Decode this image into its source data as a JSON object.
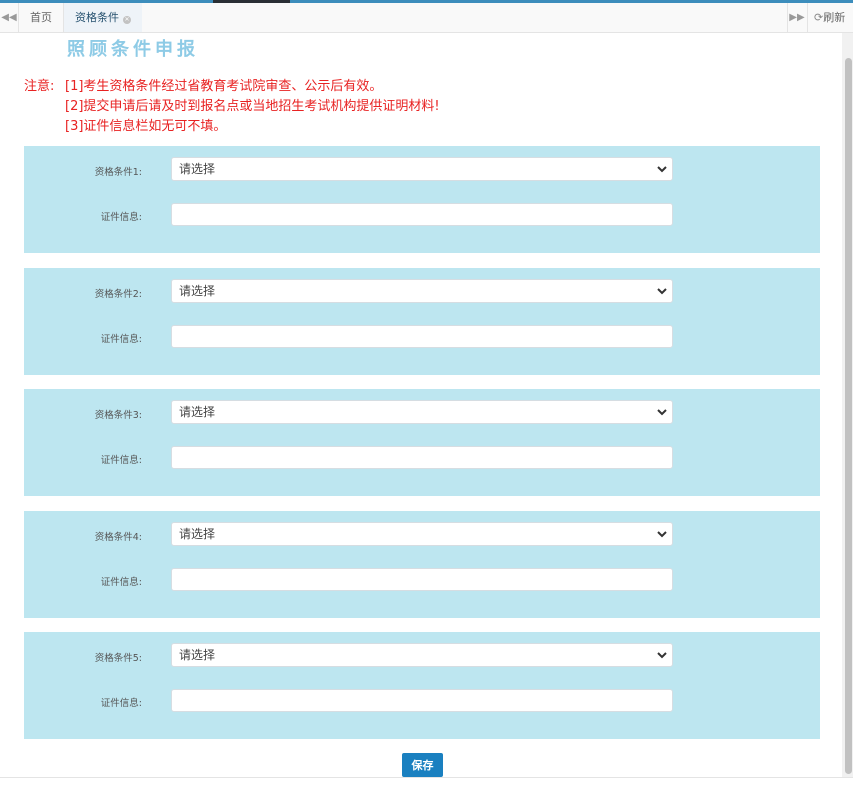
{
  "tabs": {
    "home_label": "首页",
    "current_label": "资格条件",
    "refresh_label": "刷新"
  },
  "page": {
    "title": "照顾条件申报"
  },
  "notice": {
    "head": "注意:",
    "line1": "[1]考生资格条件经过省教育考试院审查、公示后有效。",
    "line2": "[2]提交申请后请及时到报名点或当地招生考试机构提供证明材料!",
    "line3": "[3]证件信息栏如无可不填。"
  },
  "panels": [
    {
      "cond_label": "资格条件1:",
      "cert_label": "证件信息:",
      "select_value": "请选择",
      "cert_value": ""
    },
    {
      "cond_label": "资格条件2:",
      "cert_label": "证件信息:",
      "select_value": "请选择",
      "cert_value": ""
    },
    {
      "cond_label": "资格条件3:",
      "cert_label": "证件信息:",
      "select_value": "请选择",
      "cert_value": ""
    },
    {
      "cond_label": "资格条件4:",
      "cert_label": "证件信息:",
      "select_value": "请选择",
      "cert_value": ""
    },
    {
      "cond_label": "资格条件5:",
      "cert_label": "证件信息:",
      "select_value": "请选择",
      "cert_value": ""
    }
  ],
  "actions": {
    "save_label": "保存"
  },
  "colors": {
    "accent": "#3c8dbc",
    "panel_bg": "#bde6f0",
    "notice_red": "#e82222",
    "title_blue": "#8ecbe6",
    "button_blue": "#1a80c0"
  }
}
